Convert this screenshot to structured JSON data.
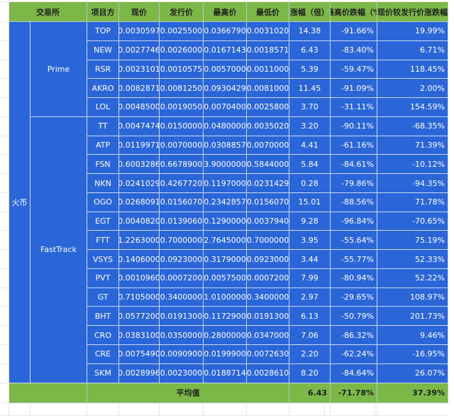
{
  "headers": [
    "交易所",
    "项目方",
    "现价",
    "发行价",
    "最高价",
    "最低价",
    "涨幅（倍）",
    "最高价跌幅（%",
    "现价较发行价涨跌幅"
  ],
  "exchange": "火币",
  "groups": [
    {
      "name": "Prime",
      "rows": [
        {
          "symbol": "TOP",
          "price": "0.0030597",
          "issue": "0.0025500",
          "high": "0.0366790",
          "low": "0.0031020",
          "gain": "14.38",
          "high_drop": "-91.66%",
          "vs_issue": "19.99%"
        },
        {
          "symbol": "NEW",
          "price": "0.0027746",
          "issue": "0.0026000",
          "high": "0.0167143",
          "low": "0.0018571",
          "gain": "6.43",
          "high_drop": "-83.40%",
          "vs_issue": "6.71%"
        },
        {
          "symbol": "RSR",
          "price": "0.0023101",
          "issue": "0.0010575",
          "high": "0.0057000",
          "low": "0.0011000",
          "gain": "5.39",
          "high_drop": "-59.47%",
          "vs_issue": "118.45%"
        },
        {
          "symbol": "AKRO",
          "price": "0.0082871",
          "issue": "0.0081250",
          "high": "0.0930429",
          "low": "0.0081000",
          "gain": "11.45",
          "high_drop": "-91.09%",
          "vs_issue": "2.00%"
        },
        {
          "symbol": "LOL",
          "price": "0.0048500",
          "issue": "0.0019050",
          "high": "0.0070400",
          "low": "0.0025800",
          "gain": "3.70",
          "high_drop": "-31.11%",
          "vs_issue": "154.59%"
        }
      ]
    },
    {
      "name": "FastTrack",
      "rows": [
        {
          "symbol": "TT",
          "price": "0.0047474",
          "issue": "0.0150000",
          "high": "0.0480000",
          "low": "0.0035020",
          "gain": "3.20",
          "high_drop": "-90.11%",
          "vs_issue": "-68.35%"
        },
        {
          "symbol": "ATP",
          "price": "0.0119971",
          "issue": "0.0070000",
          "high": "0.0308857",
          "low": "0.0070000",
          "gain": "4.41",
          "high_drop": "-61.16%",
          "vs_issue": "71.39%"
        },
        {
          "symbol": "FSN",
          "price": "0.6003286",
          "issue": "0.6678900",
          "high": "3.9000000",
          "low": "0.5844000",
          "gain": "5.84",
          "high_drop": "-84.61%",
          "vs_issue": "-10.12%"
        },
        {
          "symbol": "NKN",
          "price": "0.0241029",
          "issue": "0.4267720",
          "high": "0.1197000",
          "low": "0.0231429",
          "gain": "0.28",
          "high_drop": "-79.86%",
          "vs_issue": "-94.35%"
        },
        {
          "symbol": "OGO",
          "price": "0.0268091",
          "issue": "0.0156070",
          "high": "0.2342857",
          "low": "0.0156070",
          "gain": "15.01",
          "high_drop": "-88.56%",
          "vs_issue": "71.78%"
        },
        {
          "symbol": "EGT",
          "price": "0.0040820",
          "issue": "0.0139060",
          "high": "0.1290000",
          "low": "0.0037940",
          "gain": "9.28",
          "high_drop": "-96.84%",
          "vs_issue": "-70.65%"
        },
        {
          "symbol": "FTT",
          "price": "1.2263000",
          "issue": "0.7000000",
          "high": "2.7645000",
          "low": "0.7000000",
          "gain": "3.95",
          "high_drop": "-55.64%",
          "vs_issue": "75.19%"
        },
        {
          "symbol": "VSYS",
          "price": "0.1406000",
          "issue": "0.0923000",
          "high": "0.3179000",
          "low": "0.0923000",
          "gain": "3.44",
          "high_drop": "-55.77%",
          "vs_issue": "52.33%"
        },
        {
          "symbol": "PVT",
          "price": "0.0010960",
          "issue": "0.0007200",
          "high": "0.0057500",
          "low": "0.0007200",
          "gain": "7.99",
          "high_drop": "-80.94%",
          "vs_issue": "52.22%"
        },
        {
          "symbol": "GT",
          "price": "0.7105000",
          "issue": "0.3400000",
          "high": "1.0100000",
          "low": "0.3400000",
          "gain": "2.97",
          "high_drop": "-29.65%",
          "vs_issue": "108.97%"
        },
        {
          "symbol": "BHT",
          "price": "0.0577200",
          "issue": "0.0191300",
          "high": "0.1172900",
          "low": "0.0191300",
          "gain": "6.13",
          "high_drop": "-50.79%",
          "vs_issue": "201.73%"
        },
        {
          "symbol": "CRO",
          "price": "0.0383100",
          "issue": "0.0350000",
          "high": "0.2800000",
          "low": "0.0347000",
          "gain": "7.06",
          "high_drop": "-86.32%",
          "vs_issue": "9.46%"
        },
        {
          "symbol": "CRE",
          "price": "0.0075490",
          "issue": "0.0090900",
          "high": "0.0199900",
          "low": "0.0072630",
          "gain": "2.20",
          "high_drop": "-62.24%",
          "vs_issue": "-16.95%"
        },
        {
          "symbol": "SKM",
          "price": "0.0028996",
          "issue": "0.0023000",
          "high": "0.0188714",
          "low": "0.0028610",
          "gain": "8.20",
          "high_drop": "-84.64%",
          "vs_issue": "26.07%"
        }
      ]
    }
  ],
  "footer": {
    "label": "平均值",
    "gain": "6.43",
    "high_drop": "-71.78%",
    "vs_issue": "37.39%"
  },
  "colors": {
    "header_green": "#7cb847",
    "body_blue": "#2b66d8",
    "grid_line": "#b8c4d2"
  }
}
